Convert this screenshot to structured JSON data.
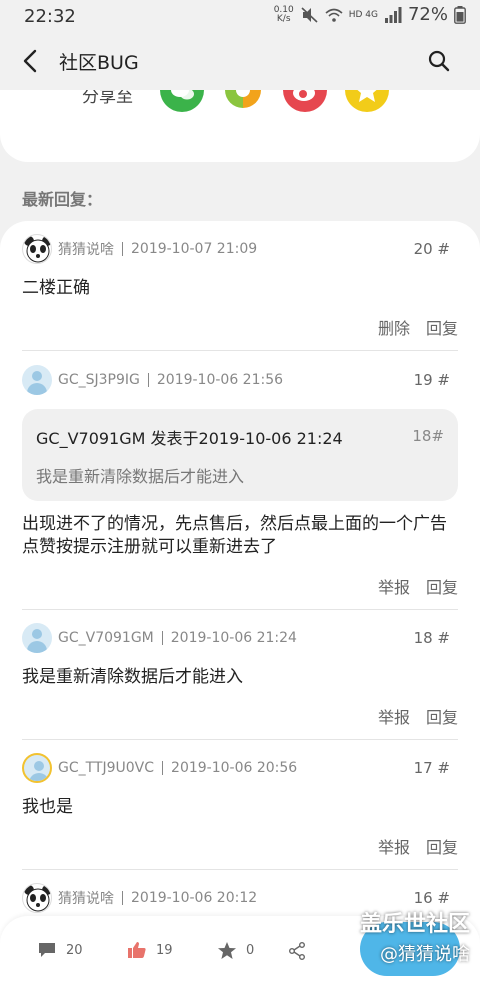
{
  "status_bar": {
    "time": "22:32",
    "net_speed_value": "0.10",
    "net_speed_unit": "K/s",
    "network_labels": "HD 4G",
    "battery": "72%"
  },
  "app_bar": {
    "title": "社区BUG",
    "back_icon": "chevron-left-icon",
    "search_icon": "search-icon"
  },
  "share": {
    "label": "分享至",
    "targets": [
      {
        "name": "wechat",
        "color": "#3bb34a"
      },
      {
        "name": "moments",
        "color": "#ffffff"
      },
      {
        "name": "weibo",
        "color": "#e6474f"
      },
      {
        "name": "qzone",
        "color": "#f2cc19"
      }
    ]
  },
  "section_title": "最新回复：",
  "replies": [
    {
      "username": "猜猜说啥",
      "date": "2019-10-07 21:09",
      "floor": "20 #",
      "content": "二楼正确",
      "actions": [
        "删除",
        "回复"
      ],
      "avatar": "panda"
    },
    {
      "username": "GC_SJ3P9IG",
      "date": "2019-10-06 21:56",
      "floor": "19 #",
      "quote": {
        "head": "GC_V7091GM 发表于2019-10-06 21:24",
        "floor": "18#",
        "text": "我是重新清除数据后才能进入"
      },
      "content": "出现进不了的情况，先点售后，然后点最上面的一个广告点赞按提示注册就可以重新进去了",
      "actions": [
        "举报",
        "回复"
      ],
      "avatar": "default"
    },
    {
      "username": "GC_V7091GM",
      "date": "2019-10-06 21:24",
      "floor": "18 #",
      "content": "我是重新清除数据后才能进入",
      "actions": [
        "举报",
        "回复"
      ],
      "avatar": "default"
    },
    {
      "username": "GC_TTJ9U0VC",
      "date": "2019-10-06 20:56",
      "floor": "17 #",
      "content": "我也是",
      "actions": [
        "举报",
        "回复"
      ],
      "avatar": "gold"
    },
    {
      "username": "猜猜说啥",
      "date": "2019-10-06 20:12",
      "floor": "16 #",
      "avatar": "panda"
    }
  ],
  "bottom_bar": {
    "comments": "20",
    "likes": "19",
    "favorites": "0",
    "icons": [
      "comment-icon",
      "thumbs-up-icon",
      "star-icon",
      "share-icon"
    ]
  },
  "watermark": {
    "line1": "盖乐世社区",
    "line2": "@猜猜说啥"
  },
  "colors": {
    "like_accent": "#e8736b",
    "fab": "#4fb6e8"
  }
}
